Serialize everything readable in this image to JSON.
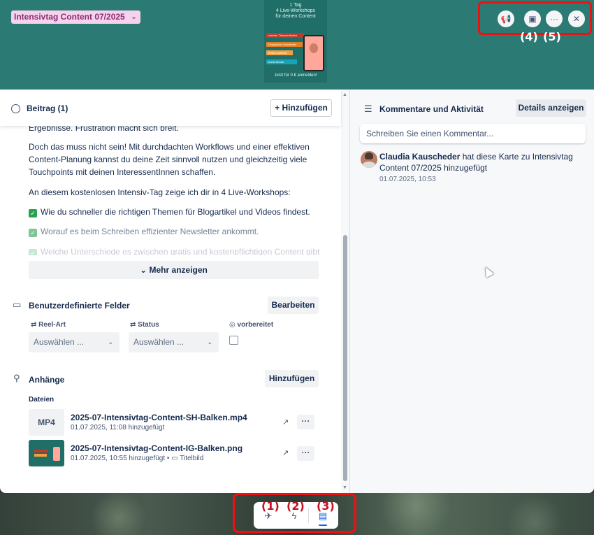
{
  "header": {
    "list_badge": "Intensivtag Content 07/2025",
    "cover": {
      "line1": "1 Tag",
      "line2": "4 Live-Workshops",
      "line3": "für deinen Content",
      "tags": [
        "Leichter Themen finden",
        "Erfolgreiche Newsletter",
        "Gratis Content?",
        "Social Media"
      ],
      "cta": "Jetzt für 0 € anmelden!"
    },
    "icons": [
      "megaphone-icon",
      "image-icon",
      "more-icon",
      "close-icon"
    ],
    "annotation_4": "(4)",
    "annotation_5": "(5)"
  },
  "checklist": {
    "title": "Beitrag (1)",
    "add_button": "Hinzufügen",
    "add_plus": "+"
  },
  "description": {
    "partial_line": "Ergebnisse. Frustration macht sich breit.",
    "para1": "Doch das muss nicht sein! Mit durchdachten Workflows und einer effektiven Content-Planung kannst du deine Zeit sinnvoll nutzen und gleichzeitig viele Touchpoints mit deinen InteressentInnen schaffen.",
    "para2": "An diesem kostenlosen Intensiv-Tag zeige ich dir in 4 Live-Workshops:",
    "bullet1": "Wie du schneller die richtigen Themen für Blogartikel und Videos findest.",
    "bullet2": "Worauf es beim Schreiben effizienter Newsletter ankommt.",
    "bullet3": "Welche Unterschiede es zwischen gratis und kostenpflichtigen Content gibt",
    "check_glyph": "✓",
    "more_button": "Mehr anzeigen"
  },
  "custom_fields": {
    "title": "Benutzerdefinierte Felder",
    "edit_button": "Bearbeiten",
    "fields": [
      {
        "label": "Reel-Art",
        "value": "Auswählen ..."
      },
      {
        "label": "Status",
        "value": "Auswählen ..."
      },
      {
        "label": "vorbereitet"
      }
    ]
  },
  "attachments": {
    "title": "Anhänge",
    "add_button": "Hinzufügen",
    "files_label": "Dateien",
    "files": [
      {
        "thumb": "MP4",
        "name": "2025-07-Intensivtag-Content-SH-Balken.mp4",
        "meta": "01.07.2025, 11:08 hinzugefügt"
      },
      {
        "name": "2025-07-Intensivtag-Content-IG-Balken.png",
        "meta": "01.07.2025, 10:55 hinzugefügt •",
        "cover_label": "Titelbild"
      }
    ],
    "open_glyph": "↗",
    "more_glyph": "···"
  },
  "activity": {
    "title": "Kommentare und Aktivität",
    "details_button": "Details anzeigen",
    "comment_placeholder": "Schreiben Sie einen Kommentar...",
    "entry": {
      "user": "Claudia Kauscheder",
      "text": "hat diese Karte zu Intensivtag Content 07/2025 hinzugefügt",
      "date": "01.07.2025, 10:53"
    }
  },
  "bottom_bar": {
    "annotations": [
      "(1)",
      "(2)",
      "(3)"
    ],
    "icons": [
      "pin-icon",
      "lightning-icon",
      "comment-icon"
    ]
  },
  "colors": {
    "header_bg": "#2b7a73",
    "badge_bg": "#f6d3ec",
    "highlight_red": "#ee1111",
    "check_green": "#2aa14f"
  }
}
